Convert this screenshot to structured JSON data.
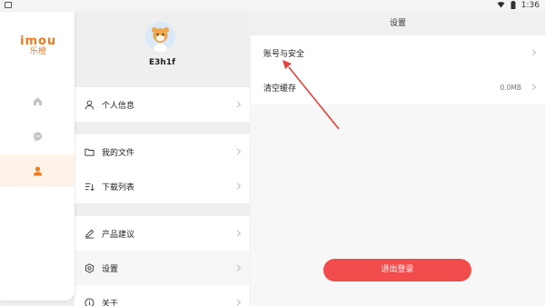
{
  "statusbar": {
    "time": "1:36",
    "icons": [
      "notification-icon",
      "wifi-icon",
      "battery-icon"
    ]
  },
  "rail": {
    "brand": "imou",
    "brand_cn": "乐橙",
    "items": [
      {
        "icon": "home-icon",
        "active": false
      },
      {
        "icon": "message-icon",
        "active": false
      },
      {
        "icon": "person-icon",
        "active": true
      }
    ],
    "accent": "#f07a1d"
  },
  "profile": {
    "username": "E3h1f",
    "groups": [
      [
        {
          "label": "个人信息",
          "icon": "user-icon"
        }
      ],
      [
        {
          "label": "我的文件",
          "icon": "folder-icon"
        },
        {
          "label": "下载列表",
          "icon": "download-list-icon"
        }
      ],
      [
        {
          "label": "产品建议",
          "icon": "pen-icon"
        },
        {
          "label": "设置",
          "icon": "gear-icon"
        },
        {
          "label": "关于",
          "icon": "info-icon"
        }
      ]
    ]
  },
  "settings": {
    "title": "设置",
    "rows": [
      {
        "label": "账号与安全",
        "value": ""
      },
      {
        "label": "清空缓存",
        "value": "0.0MB"
      }
    ],
    "logout_label": "退出登录",
    "logout_color": "#f34c4c"
  },
  "annotation": {
    "color": "#e8403a"
  }
}
